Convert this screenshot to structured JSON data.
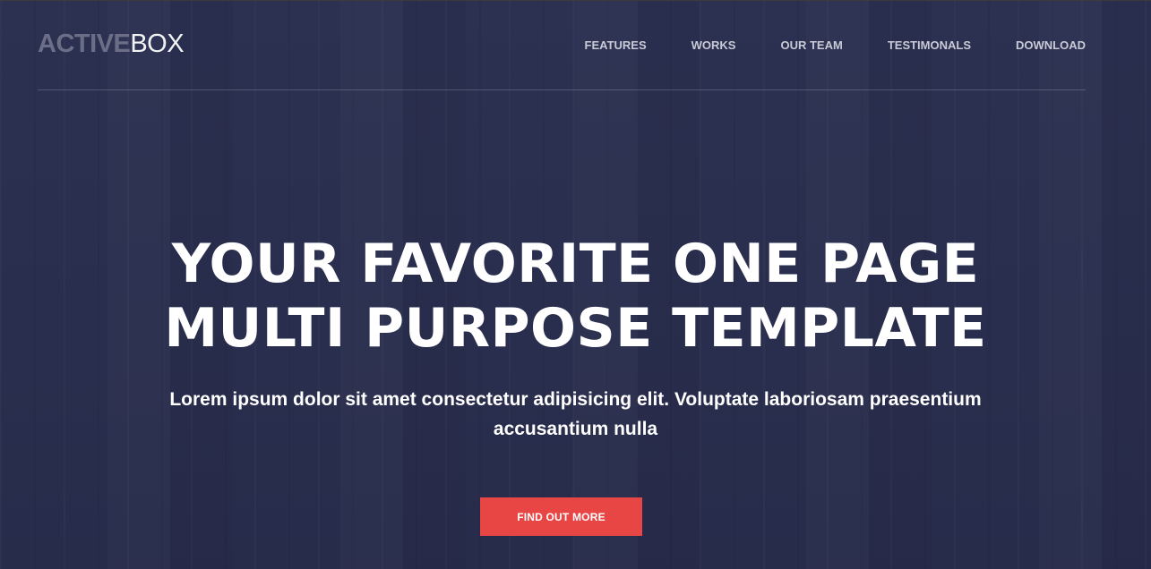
{
  "brand": {
    "name_bold": "ACTIVE",
    "name_light": "BOX"
  },
  "nav": {
    "items": [
      {
        "label": "FEATURES"
      },
      {
        "label": "WORKS"
      },
      {
        "label": "OUR TEAM"
      },
      {
        "label": "TESTIMONALS"
      },
      {
        "label": "DOWNLOAD"
      }
    ]
  },
  "hero": {
    "headline_line1": "YOUR FAVORITE ONE PAGE",
    "headline_line2": "MULTI PURPOSE TEMPLATE",
    "subtitle": "Lorem ipsum dolor sit amet consectetur adipisicing elit. Voluptate laboriosam praesentium accusantium nulla",
    "cta_label": "FIND OUT MORE"
  },
  "colors": {
    "background": "#2b2f4f",
    "accent": "#e84545",
    "logo_bold": "#6b6e86",
    "nav_text": "#c9cad6"
  }
}
